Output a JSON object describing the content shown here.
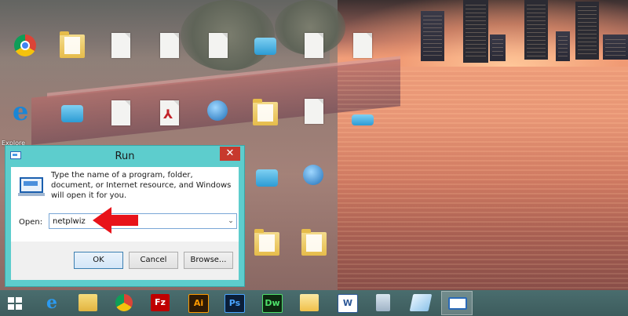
{
  "desktop": {
    "icon_labels": [
      "Explore"
    ],
    "icons": [
      "chrome-icon",
      "file-icon",
      "file-icon",
      "file-icon",
      "file-icon",
      "cloud-file-icon",
      "file-icon",
      "ie-icon",
      "cloud-file-icon",
      "file-icon",
      "pdf-icon",
      "globe-file-icon",
      "folder-icon",
      "file-icon",
      "cloud-file-icon",
      "globe-file-icon",
      "folder-icon",
      "folder-icon"
    ]
  },
  "run_dialog": {
    "title": "Run",
    "close_glyph": "✕",
    "description": "Type the name of a program, folder, document, or Internet resource, and Windows will open it for you.",
    "open_label": "Open:",
    "open_value": "netplwiz",
    "dropdown_glyph": "⌄",
    "ok_label": "OK",
    "cancel_label": "Cancel",
    "browse_label": "Browse..."
  },
  "annotation": {
    "arrow_color": "#e8131a",
    "arrow_points_to": "open-input"
  },
  "taskbar": {
    "items": [
      {
        "name": "start-button",
        "icon": "windows-logo"
      },
      {
        "name": "internet-explorer",
        "icon": "ie-icon",
        "glyph": "e"
      },
      {
        "name": "file-explorer",
        "icon": "folder-icon"
      },
      {
        "name": "google-chrome",
        "icon": "chrome-icon"
      },
      {
        "name": "filezilla",
        "icon": "filezilla-icon",
        "glyph": "Fz"
      },
      {
        "name": "adobe-illustrator",
        "icon": "illustrator-icon",
        "glyph": "Ai"
      },
      {
        "name": "adobe-photoshop",
        "icon": "photoshop-icon",
        "glyph": "Ps"
      },
      {
        "name": "adobe-dreamweaver",
        "icon": "dreamweaver-icon",
        "glyph": "Dw"
      },
      {
        "name": "outlook",
        "icon": "outlook-icon"
      },
      {
        "name": "microsoft-word",
        "icon": "word-icon",
        "glyph": "W"
      },
      {
        "name": "calculator",
        "icon": "calculator-icon"
      },
      {
        "name": "notes",
        "icon": "notes-icon"
      },
      {
        "name": "run",
        "icon": "run-icon",
        "active": true
      }
    ]
  },
  "colors": {
    "dialog_frame": "#5dcdcd",
    "close_button": "#c7392d",
    "taskbar": "#446566",
    "accent_arrow": "#e8131a"
  }
}
